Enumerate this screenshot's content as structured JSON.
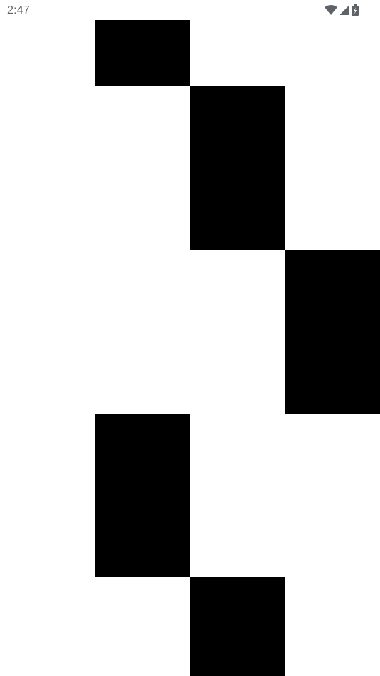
{
  "status_bar": {
    "time": "2:47",
    "icons": [
      "wifi-icon",
      "cell-signal-icon",
      "battery-charging-icon"
    ],
    "icon_color": "#5f6368"
  },
  "game": {
    "background_color": "#ffffff",
    "tile_color": "#000000",
    "lanes": 4,
    "tiles": [
      {
        "lane": 2
      },
      {
        "lane": 3
      },
      {
        "lane": 4
      },
      {
        "lane": 2
      },
      {
        "lane": 3
      }
    ]
  }
}
